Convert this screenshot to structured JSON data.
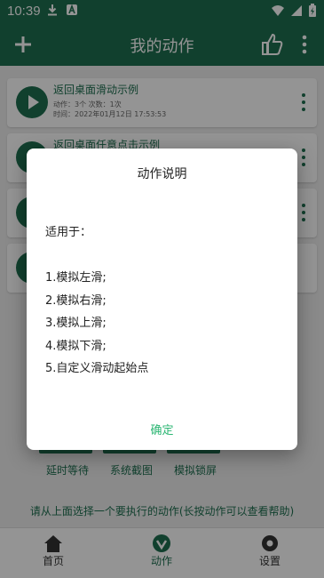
{
  "status": {
    "time": "10:39"
  },
  "appbar": {
    "title": "我的动作"
  },
  "cards": [
    {
      "title": "返回桌面滑动示例",
      "meta": "动作：3个 次数：1次",
      "time": "时间：2022年01月12日 17:53:53"
    },
    {
      "title": "返回桌面任意点击示例"
    }
  ],
  "quick_buttons": [
    {
      "label": "延时等待"
    },
    {
      "label": "系统截图"
    },
    {
      "label": "模拟锁屏"
    }
  ],
  "help_text": "请从上面选择一个要执行的动作(长按动作可以查看帮助)",
  "nav": {
    "home": "首页",
    "actions": "动作",
    "settings": "设置"
  },
  "dialog": {
    "title": "动作说明",
    "applies": "适用于：",
    "items": [
      "1.模拟左滑;",
      "2.模拟右滑;",
      "3.模拟上滑;",
      "4.模拟下滑;",
      "5.自定义滑动起始点"
    ],
    "ok": "确定"
  },
  "colors": {
    "primary": "#1e6f50",
    "accent": "#2bb673",
    "scrim": "rgba(0,0,0,0.42)"
  }
}
